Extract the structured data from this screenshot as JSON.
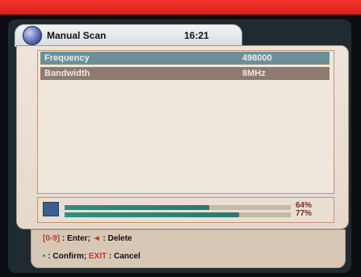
{
  "header": {
    "title": "Manual Scan",
    "time": "16:21"
  },
  "list": {
    "frequency": {
      "label": "Frequency",
      "value": "498000"
    },
    "bandwidth": {
      "label": "Bandwidth",
      "value": "8MHz"
    }
  },
  "signal": {
    "strength_percent": 64,
    "quality_percent": 77,
    "strength_text": "64%",
    "quality_text": "77%"
  },
  "help": {
    "line1_key": "[0-9]",
    "line1_text1": ": Enter;",
    "line1_key2": "◄",
    "line1_text2": ": Delete",
    "line2_key1": "•",
    "line2_text1": ": Confirm;",
    "line2_key2": "EXIT",
    "line2_text2": ": Cancel"
  },
  "colors": {
    "topbar": "#e32b22",
    "selected_row": "#6f8f97",
    "row": "#8d7b6f",
    "bar": "#2f8f7c"
  },
  "icons": {
    "title_icon": "globe-icon",
    "signal_icon": "signal-icon"
  }
}
